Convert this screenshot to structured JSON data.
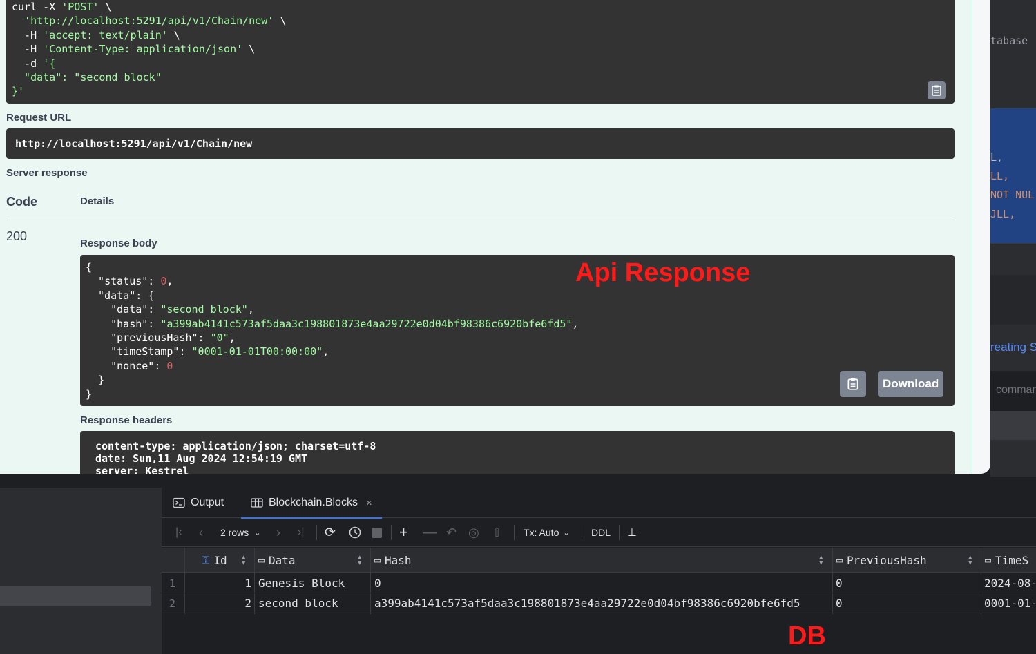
{
  "ide_right": {
    "top_text": "tabase",
    "code_lines": [
      "L,",
      "LL,",
      "NOT NUL",
      "JLL,"
    ],
    "link_text": "reating S",
    "hint_text": "comman"
  },
  "swagger": {
    "curl_lines": [
      {
        "parts": [
          [
            "curl -X ",
            ""
          ],
          [
            "'POST'",
            "green"
          ],
          [
            " \\",
            ""
          ]
        ]
      },
      {
        "parts": [
          [
            "  ",
            ""
          ],
          [
            "'http://localhost:5291/api/v1/Chain/new'",
            "green"
          ],
          [
            " \\",
            ""
          ]
        ]
      },
      {
        "parts": [
          [
            "  -H ",
            ""
          ],
          [
            "'accept: text/plain'",
            "green"
          ],
          [
            " \\",
            ""
          ]
        ]
      },
      {
        "parts": [
          [
            "  -H ",
            ""
          ],
          [
            "'Content-Type: application/json'",
            "green"
          ],
          [
            " \\",
            ""
          ]
        ]
      },
      {
        "parts": [
          [
            "  -d ",
            ""
          ],
          [
            "'{",
            "green"
          ]
        ]
      },
      {
        "parts": [
          [
            "  \"data\": \"second block\"",
            "green"
          ]
        ]
      },
      {
        "parts": [
          [
            "}'",
            "green"
          ]
        ]
      }
    ],
    "request_url_label": "Request URL",
    "request_url": "http://localhost:5291/api/v1/Chain/new",
    "server_response_label": "Server response",
    "code_header": "Code",
    "details_header": "Details",
    "status_code": "200",
    "response_body_label": "Response body",
    "response_lines": [
      {
        "parts": [
          [
            "{",
            ""
          ]
        ]
      },
      {
        "parts": [
          [
            "  \"status\": ",
            ""
          ],
          [
            "0",
            "red"
          ],
          [
            ",",
            ""
          ]
        ]
      },
      {
        "parts": [
          [
            "  \"data\": {",
            ""
          ]
        ]
      },
      {
        "parts": [
          [
            "    \"data\": ",
            ""
          ],
          [
            "\"second block\"",
            "green"
          ],
          [
            ",",
            ""
          ]
        ]
      },
      {
        "parts": [
          [
            "    \"hash\": ",
            ""
          ],
          [
            "\"a399ab4141c573af5daa3c198801873e4aa29722e0d04bf98386c6920bfe6fd5\"",
            "green"
          ],
          [
            ",",
            ""
          ]
        ]
      },
      {
        "parts": [
          [
            "    \"previousHash\": ",
            ""
          ],
          [
            "\"0\"",
            "green"
          ],
          [
            ",",
            ""
          ]
        ]
      },
      {
        "parts": [
          [
            "    \"timeStamp\": ",
            ""
          ],
          [
            "\"0001-01-01T00:00:00\"",
            "green"
          ],
          [
            ",",
            ""
          ]
        ]
      },
      {
        "parts": [
          [
            "    \"nonce\": ",
            ""
          ],
          [
            "0",
            "red"
          ]
        ]
      },
      {
        "parts": [
          [
            "  }",
            ""
          ]
        ]
      },
      {
        "parts": [
          [
            "}",
            ""
          ]
        ]
      }
    ],
    "download_label": "Download",
    "response_headers_label": "Response headers",
    "response_headers": [
      "content-type: application/json; charset=utf-8",
      "date: Sun,11 Aug 2024 12:54:19 GMT",
      "server: Kestrel"
    ]
  },
  "annotations": {
    "api": "Api Response",
    "db": "DB"
  },
  "db": {
    "tabs": [
      {
        "label": "Output",
        "icon": "console-icon"
      },
      {
        "label": "Blockchain.Blocks",
        "icon": "table-icon",
        "active": true
      }
    ],
    "rows_label": "2 rows",
    "tx_label": "Tx: Auto",
    "ddl_label": "DDL",
    "columns": [
      "Id",
      "Data",
      "Hash",
      "PreviousHash",
      "TimeS"
    ],
    "rows": [
      {
        "n": "1",
        "id": "1",
        "data": "Genesis Block",
        "hash": "0",
        "prev": "0",
        "time": "2024-08-"
      },
      {
        "n": "2",
        "id": "2",
        "data": "second block",
        "hash": "a399ab4141c573af5daa3c198801873e4aa29722e0d04bf98386c6920bfe6fd5",
        "prev": "0",
        "time": "0001-01-"
      }
    ]
  },
  "colors": {
    "annotation_red": "#ff1a1a",
    "swagger_bg": "#ebf7f2",
    "code_bg": "#333333",
    "string_green": "#a2fca2",
    "number_red": "#d36363",
    "ide_bg": "#1e1f22",
    "ide_accent": "#3574f0"
  }
}
